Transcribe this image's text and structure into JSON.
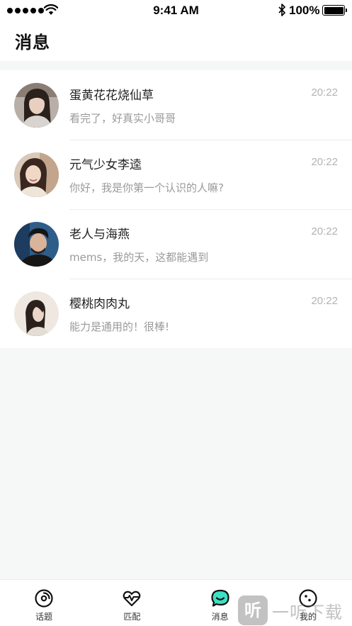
{
  "status_bar": {
    "time": "9:41 AM",
    "battery_percent": "100%",
    "battery_level": 1.0,
    "icons": [
      "signal-dots-icon",
      "wifi-icon",
      "bluetooth-icon",
      "battery-icon"
    ]
  },
  "header": {
    "title": "消息"
  },
  "messages": [
    {
      "name": "蛋黄花花烧仙草",
      "time": "20:22",
      "preview": "看完了，好真实小哥哥",
      "avatar": "avatar-woman-long-hair"
    },
    {
      "name": "元气少女李逵",
      "time": "20:22",
      "preview": "你好，我是你第一个认识的人嘛?",
      "avatar": "avatar-woman-smiling"
    },
    {
      "name": "老人与海燕",
      "time": "20:22",
      "preview": "mems，我的天，这都能遇到",
      "avatar": "avatar-man"
    },
    {
      "name": "樱桃肉肉丸",
      "time": "20:22",
      "preview": "能力是通用的！很棒!",
      "avatar": "avatar-woman-profile"
    }
  ],
  "tab_bar": {
    "tabs": [
      {
        "label": "话题",
        "icon": "topic-icon",
        "active": false
      },
      {
        "label": "匹配",
        "icon": "heart-pulse-icon",
        "active": false
      },
      {
        "label": "消息",
        "icon": "message-bubble-icon",
        "active": true
      },
      {
        "label": "我的",
        "icon": "profile-face-icon",
        "active": false
      }
    ]
  },
  "colors": {
    "accent": "#3ee0c2",
    "background": "#f6f7f7",
    "muted_text": "#9a9a9a",
    "time_text": "#b3b3b3"
  },
  "watermark": {
    "logo": "听",
    "text": "一听下载"
  }
}
